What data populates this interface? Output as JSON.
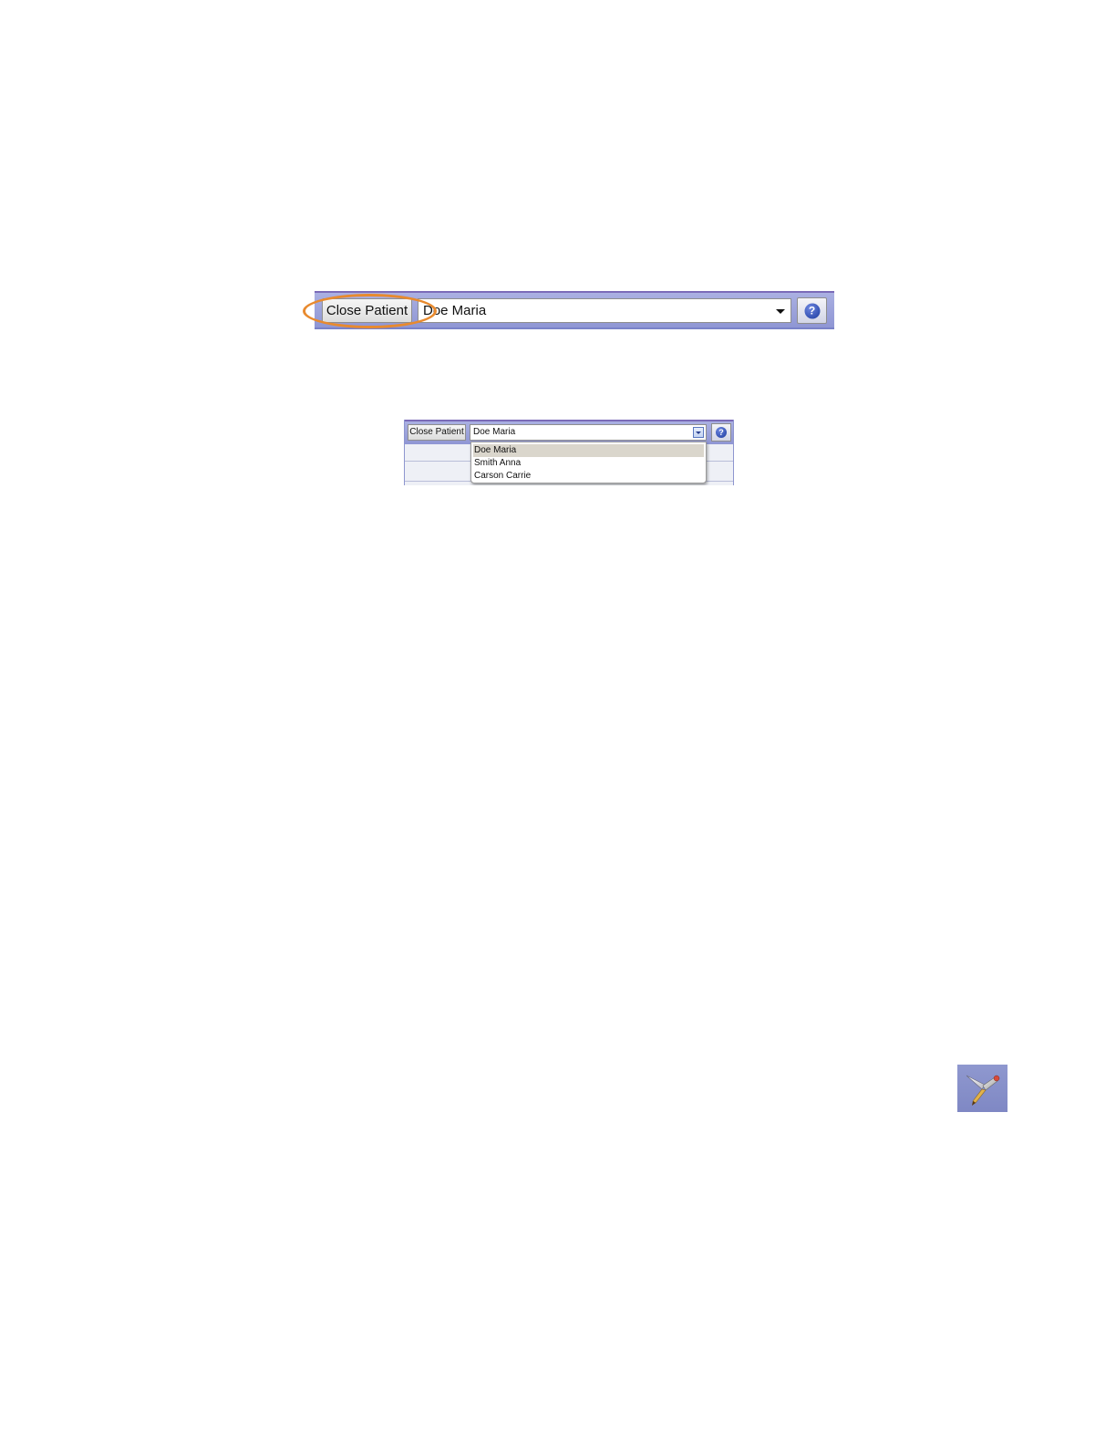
{
  "toolbar_large": {
    "close_label": "Close Patient",
    "patient_value": "Doe Maria",
    "help_icon": "help-icon",
    "help_glyph": "?"
  },
  "toolbar_small": {
    "close_label": "Close Patient",
    "patient_value": "Doe Maria",
    "help_glyph": "?",
    "dropdown_options": [
      "Doe Maria",
      "Smith Anna",
      "Carson Carrie"
    ],
    "selected_option": "Doe Maria"
  },
  "colors": {
    "toolbar": "#9aa1da",
    "highlight": "#e88a2e",
    "help": "#1b3a9e",
    "selected_row": "#dad6cc"
  },
  "icons": {
    "tool_icon": "pen-tool-icon"
  }
}
